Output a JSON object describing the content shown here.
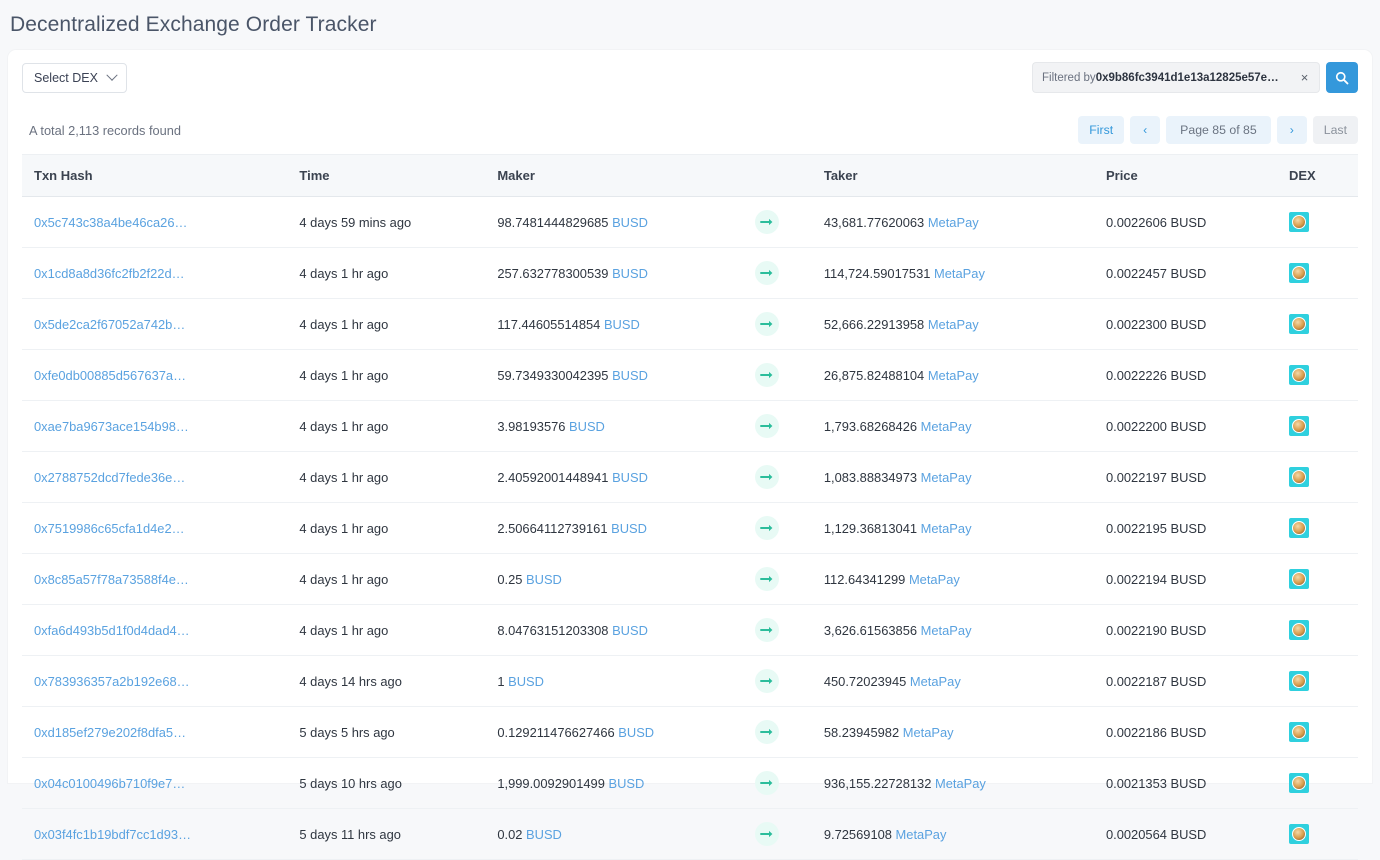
{
  "page": {
    "title": "Decentralized Exchange Order Tracker"
  },
  "toolbar": {
    "dex_select_label": "Select DEX",
    "chevron_icon": "chevron-down-icon",
    "filter_prefix": "Filtered by ",
    "filter_value": "0x9b86fc3941d1e13a12825e57e…",
    "clear_label": "×",
    "search_icon": "search-icon"
  },
  "summary": {
    "records_text": "A total 2,113 records found"
  },
  "pagination": {
    "first": "First",
    "prev": "‹",
    "page_label": "Page 85 of 85",
    "next": "›",
    "last": "Last",
    "current_page": 85,
    "total_pages": 85
  },
  "table": {
    "columns": [
      "Txn Hash",
      "Time",
      "Maker",
      "",
      "Taker",
      "Price",
      "DEX"
    ],
    "arrow_icon": "arrow-right-icon",
    "dex_icon": "pancake-dex-icon",
    "rows": [
      {
        "hash": "0x5c743c38a4be46ca26…",
        "time": "4 days 59 mins ago",
        "maker_amount": "98.7481444829685",
        "maker_token": "BUSD",
        "taker_amount": "43,681.77620063",
        "taker_token": "MetaPay",
        "price": "0.0022606 BUSD"
      },
      {
        "hash": "0x1cd8a8d36fc2fb2f22d…",
        "time": "4 days 1 hr ago",
        "maker_amount": "257.632778300539",
        "maker_token": "BUSD",
        "taker_amount": "114,724.59017531",
        "taker_token": "MetaPay",
        "price": "0.0022457 BUSD"
      },
      {
        "hash": "0x5de2ca2f67052a742b…",
        "time": "4 days 1 hr ago",
        "maker_amount": "117.44605514854",
        "maker_token": "BUSD",
        "taker_amount": "52,666.22913958",
        "taker_token": "MetaPay",
        "price": "0.0022300 BUSD"
      },
      {
        "hash": "0xfe0db00885d567637a…",
        "time": "4 days 1 hr ago",
        "maker_amount": "59.7349330042395",
        "maker_token": "BUSD",
        "taker_amount": "26,875.82488104",
        "taker_token": "MetaPay",
        "price": "0.0022226 BUSD"
      },
      {
        "hash": "0xae7ba9673ace154b98…",
        "time": "4 days 1 hr ago",
        "maker_amount": "3.98193576",
        "maker_token": "BUSD",
        "taker_amount": "1,793.68268426",
        "taker_token": "MetaPay",
        "price": "0.0022200 BUSD"
      },
      {
        "hash": "0x2788752dcd7fede36e…",
        "time": "4 days 1 hr ago",
        "maker_amount": "2.40592001448941",
        "maker_token": "BUSD",
        "taker_amount": "1,083.88834973",
        "taker_token": "MetaPay",
        "price": "0.0022197 BUSD"
      },
      {
        "hash": "0x7519986c65cfa1d4e2…",
        "time": "4 days 1 hr ago",
        "maker_amount": "2.50664112739161",
        "maker_token": "BUSD",
        "taker_amount": "1,129.36813041",
        "taker_token": "MetaPay",
        "price": "0.0022195 BUSD"
      },
      {
        "hash": "0x8c85a57f78a73588f4e…",
        "time": "4 days 1 hr ago",
        "maker_amount": "0.25",
        "maker_token": "BUSD",
        "taker_amount": "112.64341299",
        "taker_token": "MetaPay",
        "price": "0.0022194 BUSD"
      },
      {
        "hash": "0xfa6d493b5d1f0d4dad4…",
        "time": "4 days 1 hr ago",
        "maker_amount": "8.04763151203308",
        "maker_token": "BUSD",
        "taker_amount": "3,626.61563856",
        "taker_token": "MetaPay",
        "price": "0.0022190 BUSD"
      },
      {
        "hash": "0x783936357a2b192e68…",
        "time": "4 days 14 hrs ago",
        "maker_amount": "1",
        "maker_token": "BUSD",
        "taker_amount": "450.72023945",
        "taker_token": "MetaPay",
        "price": "0.0022187 BUSD"
      },
      {
        "hash": "0xd185ef279e202f8dfa5…",
        "time": "5 days 5 hrs ago",
        "maker_amount": "0.129211476627466",
        "maker_token": "BUSD",
        "taker_amount": "58.23945982",
        "taker_token": "MetaPay",
        "price": "0.0022186 BUSD"
      },
      {
        "hash": "0x04c0100496b710f9e7…",
        "time": "5 days 10 hrs ago",
        "maker_amount": "1,999.0092901499",
        "maker_token": "BUSD",
        "taker_amount": "936,155.22728132",
        "taker_token": "MetaPay",
        "price": "0.0021353 BUSD"
      },
      {
        "hash": "0x03f4fc1b19bdf7cc1d93…",
        "time": "5 days 11 hrs ago",
        "maker_amount": "0.02",
        "maker_token": "BUSD",
        "taker_amount": "9.72569108",
        "taker_token": "MetaPay",
        "price": "0.0020564 BUSD"
      }
    ]
  },
  "colors": {
    "accent": "#3498db",
    "link": "#5aa2e0",
    "arrow": "#2bbd9b",
    "dex_badge": "#2fd0de",
    "page_bg": "#f7f8fa"
  }
}
